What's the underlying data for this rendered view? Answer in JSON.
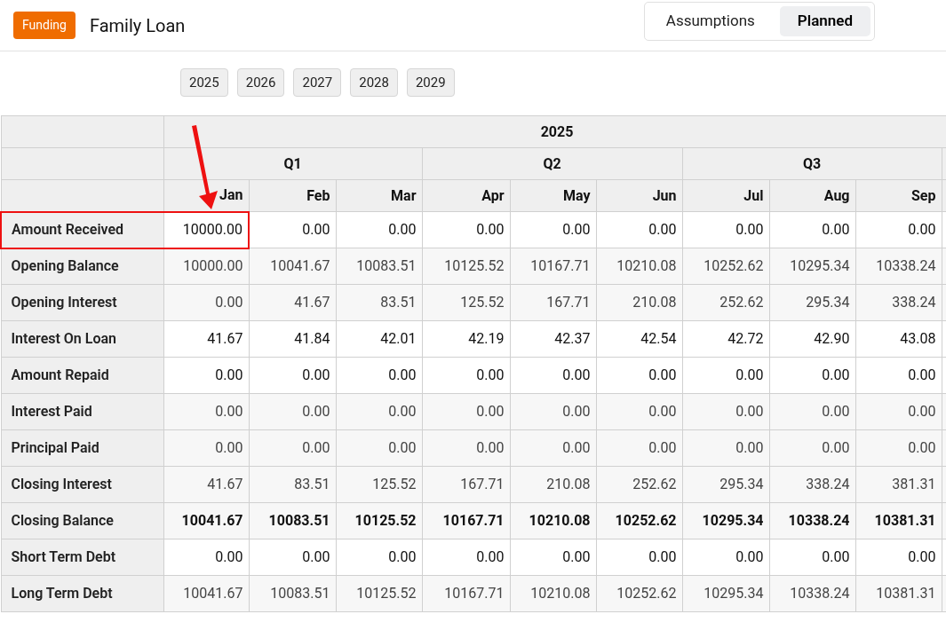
{
  "header": {
    "badge": "Funding",
    "title": "Family Loan",
    "tabs": [
      {
        "label": "Assumptions",
        "selected": false
      },
      {
        "label": "Planned",
        "selected": true
      }
    ]
  },
  "years": [
    "2025",
    "2026",
    "2027",
    "2028",
    "2029"
  ],
  "table": {
    "year": "2025",
    "quarters": [
      {
        "label": "Q1",
        "months": [
          "Jan",
          "Feb",
          "Mar"
        ]
      },
      {
        "label": "Q2",
        "months": [
          "Apr",
          "May",
          "Jun"
        ]
      },
      {
        "label": "Q3",
        "months": [
          "Jul",
          "Aug",
          "Sep"
        ]
      }
    ],
    "rows": [
      {
        "label": "Amount Received",
        "kind": "input",
        "highlighted": true,
        "values": [
          "10000.00",
          "0.00",
          "0.00",
          "0.00",
          "0.00",
          "0.00",
          "0.00",
          "0.00",
          "0.00"
        ]
      },
      {
        "label": "Opening Balance",
        "kind": "computed",
        "highlighted": false,
        "values": [
          "10000.00",
          "10041.67",
          "10083.51",
          "10125.52",
          "10167.71",
          "10210.08",
          "10252.62",
          "10295.34",
          "10338.24"
        ]
      },
      {
        "label": "Opening Interest",
        "kind": "computed",
        "highlighted": false,
        "values": [
          "0.00",
          "41.67",
          "83.51",
          "125.52",
          "167.71",
          "210.08",
          "252.62",
          "295.34",
          "338.24"
        ]
      },
      {
        "label": "Interest On Loan",
        "kind": "input",
        "highlighted": false,
        "values": [
          "41.67",
          "41.84",
          "42.01",
          "42.19",
          "42.37",
          "42.54",
          "42.72",
          "42.90",
          "43.08"
        ]
      },
      {
        "label": "Amount Repaid",
        "kind": "input",
        "highlighted": false,
        "values": [
          "0.00",
          "0.00",
          "0.00",
          "0.00",
          "0.00",
          "0.00",
          "0.00",
          "0.00",
          "0.00"
        ]
      },
      {
        "label": "Interest Paid",
        "kind": "computed",
        "highlighted": false,
        "values": [
          "0.00",
          "0.00",
          "0.00",
          "0.00",
          "0.00",
          "0.00",
          "0.00",
          "0.00",
          "0.00"
        ]
      },
      {
        "label": "Principal Paid",
        "kind": "computed",
        "highlighted": false,
        "values": [
          "0.00",
          "0.00",
          "0.00",
          "0.00",
          "0.00",
          "0.00",
          "0.00",
          "0.00",
          "0.00"
        ]
      },
      {
        "label": "Closing Interest",
        "kind": "computed",
        "highlighted": false,
        "values": [
          "41.67",
          "83.51",
          "125.52",
          "167.71",
          "210.08",
          "252.62",
          "295.34",
          "338.24",
          "381.31"
        ]
      },
      {
        "label": "Closing Balance",
        "kind": "total",
        "highlighted": false,
        "values": [
          "10041.67",
          "10083.51",
          "10125.52",
          "10167.71",
          "10210.08",
          "10252.62",
          "10295.34",
          "10338.24",
          "10381.31"
        ]
      },
      {
        "label": "Short Term Debt",
        "kind": "input",
        "highlighted": false,
        "values": [
          "0.00",
          "0.00",
          "0.00",
          "0.00",
          "0.00",
          "0.00",
          "0.00",
          "0.00",
          "0.00"
        ]
      },
      {
        "label": "Long Term Debt",
        "kind": "computed",
        "highlighted": false,
        "values": [
          "10041.67",
          "10083.51",
          "10125.52",
          "10167.71",
          "10210.08",
          "10252.62",
          "10295.34",
          "10338.24",
          "10381.31"
        ]
      }
    ]
  }
}
